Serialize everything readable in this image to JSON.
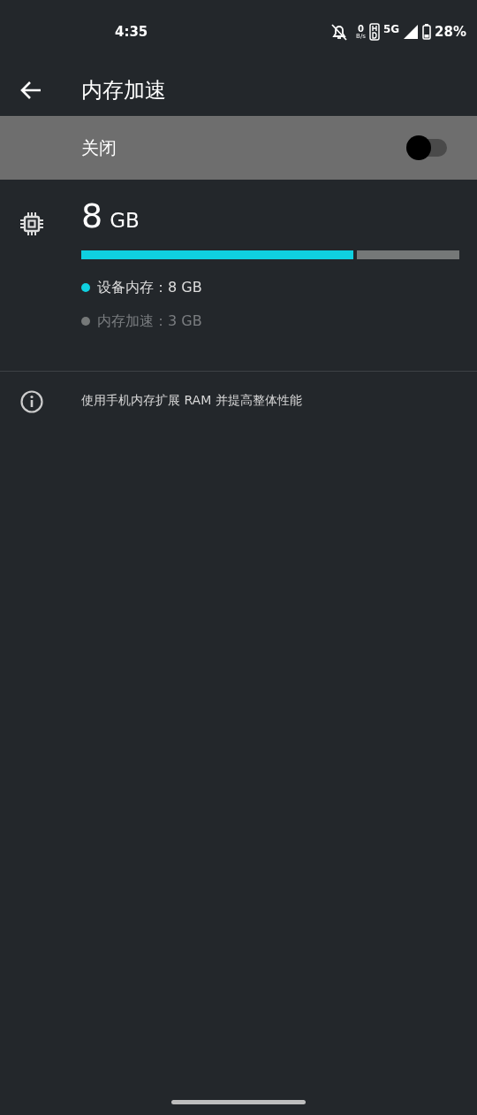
{
  "status_bar": {
    "time": "4:35",
    "speed_value": "0",
    "speed_unit": "B/s",
    "network": "5G",
    "battery": "28%"
  },
  "app_bar": {
    "title": "内存加速"
  },
  "master_switch": {
    "label": "关闭",
    "on": false
  },
  "memory": {
    "total_value": "8",
    "total_unit": "GB",
    "level": 0.73,
    "segments": [
      {
        "label": "设备内存：8 GB",
        "color": "#0fd0e0",
        "dimmed": false
      },
      {
        "label": "内存加速：3 GB",
        "color": "#757878",
        "dimmed": true
      }
    ]
  },
  "info": {
    "text": "使用手机内存扩展 RAM 并提高整体性能"
  }
}
